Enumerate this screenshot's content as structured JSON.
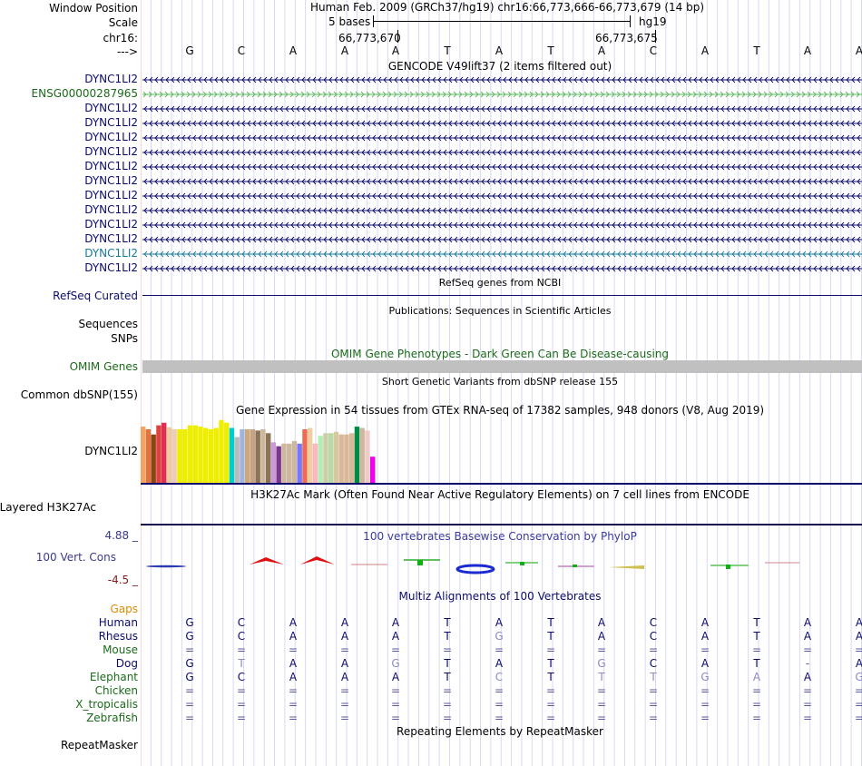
{
  "header": {
    "window_position_label": "Window Position",
    "scale_label": "Scale",
    "chrom_label": "chr16:",
    "arrow_label": "--->",
    "assembly_title": "Human Feb. 2009 (GRCh37/hg19)   chr16:66,773,666-66,773,679 (14 bp)",
    "scale_text": "5 bases",
    "scale_db": "hg19",
    "pos1": "66,773,670",
    "pos2": "66,773,675"
  },
  "sequence": [
    "G",
    "C",
    "A",
    "A",
    "A",
    "T",
    "A",
    "T",
    "A",
    "C",
    "A",
    "T",
    "A",
    "A"
  ],
  "gencode": {
    "title": "GENCODE V49lift37 (2 items filtered out)",
    "items": [
      {
        "label": "DYNC1LI2",
        "color": "#0b0b6e"
      },
      {
        "label": "ENSG00000287965",
        "color": "#1a6b1a"
      },
      {
        "label": "DYNC1LI2",
        "color": "#0b0b6e"
      },
      {
        "label": "DYNC1LI2",
        "color": "#0b0b6e"
      },
      {
        "label": "DYNC1LI2",
        "color": "#0b0b6e"
      },
      {
        "label": "DYNC1LI2",
        "color": "#0b0b6e"
      },
      {
        "label": "DYNC1LI2",
        "color": "#0b0b6e"
      },
      {
        "label": "DYNC1LI2",
        "color": "#0b0b6e"
      },
      {
        "label": "DYNC1LI2",
        "color": "#0b0b6e"
      },
      {
        "label": "DYNC1LI2",
        "color": "#0b0b6e"
      },
      {
        "label": "DYNC1LI2",
        "color": "#0b0b6e"
      },
      {
        "label": "DYNC1LI2",
        "color": "#0b0b6e"
      },
      {
        "label": "DYNC1LI2",
        "color": "#1a7a9a"
      },
      {
        "label": "DYNC1LI2",
        "color": "#0b0b6e"
      }
    ]
  },
  "refseq": {
    "title": "RefSeq genes from NCBI",
    "label": "RefSeq Curated"
  },
  "publications": {
    "title": "Publications: Sequences in Scientific Articles",
    "label1": "Sequences",
    "label2": "SNPs"
  },
  "omim": {
    "title": "OMIM Gene Phenotypes - Dark Green Can Be Disease-causing",
    "label": "OMIM Genes"
  },
  "dbsnp": {
    "title": "Short Genetic Variants from dbSNP release 155",
    "label": "Common dbSNP(155)"
  },
  "gtex": {
    "title": "Gene Expression in 54 tissues from GTEx RNA-seq of 17382 samples, 948 donors (V8, Aug 2019)",
    "label": "DYNC1LI2",
    "bars": [
      {
        "v": 0.86,
        "c": "#f4a460"
      },
      {
        "v": 0.82,
        "c": "#e0743c"
      },
      {
        "v": 0.74,
        "c": "#8b4513"
      },
      {
        "v": 0.88,
        "c": "#e04040"
      },
      {
        "v": 0.92,
        "c": "#e03050"
      },
      {
        "v": 0.85,
        "c": "#eecaa0"
      },
      {
        "v": 0.82,
        "c": "#eeccbb"
      },
      {
        "v": 0.82,
        "c": "#eeee00"
      },
      {
        "v": 0.82,
        "c": "#eeee00"
      },
      {
        "v": 0.88,
        "c": "#eeee00"
      },
      {
        "v": 0.88,
        "c": "#eeee00"
      },
      {
        "v": 0.86,
        "c": "#eeee00"
      },
      {
        "v": 0.84,
        "c": "#eeee00"
      },
      {
        "v": 0.82,
        "c": "#eeee00"
      },
      {
        "v": 0.84,
        "c": "#eeee00"
      },
      {
        "v": 0.96,
        "c": "#eeee00"
      },
      {
        "v": 0.92,
        "c": "#eeee00"
      },
      {
        "v": 0.84,
        "c": "#00cdcd"
      },
      {
        "v": 0.7,
        "c": "#bbbbbb"
      },
      {
        "v": 0.82,
        "c": "#a0b4dd"
      },
      {
        "v": 0.82,
        "c": "#cfa87a"
      },
      {
        "v": 0.82,
        "c": "#c4a484"
      },
      {
        "v": 0.8,
        "c": "#8b7355"
      },
      {
        "v": 0.82,
        "c": "#cdb79e"
      },
      {
        "v": 0.76,
        "c": "#8b7355"
      },
      {
        "v": 0.62,
        "c": "#c89ad8"
      },
      {
        "v": 0.56,
        "c": "#7a378b"
      },
      {
        "v": 0.6,
        "c": "#cdb79e"
      },
      {
        "v": 0.6,
        "c": "#cdb79e"
      },
      {
        "v": 0.64,
        "c": "#cdb79e"
      },
      {
        "v": 0.6,
        "c": "#7777ff"
      },
      {
        "v": 0.82,
        "c": "#ee6a50"
      },
      {
        "v": 0.84,
        "c": "#eecfa1"
      },
      {
        "v": 0.6,
        "c": "#ffb6c1"
      },
      {
        "v": 0.72,
        "c": "#b4eeb4"
      },
      {
        "v": 0.76,
        "c": "#cdcdaa"
      },
      {
        "v": 0.76,
        "c": "#b8d8a8"
      },
      {
        "v": 0.78,
        "c": "#d8c8a0"
      },
      {
        "v": 0.74,
        "c": "#d8b898"
      },
      {
        "v": 0.74,
        "c": "#d8b898"
      },
      {
        "v": 0.76,
        "c": "#d8b898"
      },
      {
        "v": 0.86,
        "c": "#008b45"
      },
      {
        "v": 0.84,
        "c": "#cdb79e"
      },
      {
        "v": 0.8,
        "c": "#eecbc8"
      },
      {
        "v": 0.4,
        "c": "#ee00ee"
      }
    ]
  },
  "h3k27ac": {
    "title": "H3K27Ac Mark (Often Found Near Active Regulatory Elements) on 7 cell lines from ENCODE",
    "label": "Layered H3K27Ac"
  },
  "phylop": {
    "title": "100 vertebrates Basewise Conservation by PhyloP",
    "label": "100 Vert. Cons",
    "ymax": "4.88 _",
    "ymin": "-4.5 _"
  },
  "multiz": {
    "title": "Multiz Alignments of 100 Vertebrates",
    "gaps_label": "Gaps",
    "species": [
      {
        "name": "Human",
        "color": "#0b0b6e",
        "seq": [
          "G",
          "C",
          "A",
          "A",
          "A",
          "T",
          "A",
          "T",
          "A",
          "C",
          "A",
          "T",
          "A",
          "A"
        ]
      },
      {
        "name": "Rhesus",
        "color": "#0b0b6e",
        "seq": [
          "G",
          "C",
          "A",
          "A",
          "A",
          "T",
          "G",
          "T",
          "A",
          "C",
          "A",
          "T",
          "A",
          "A"
        ]
      },
      {
        "name": "Mouse",
        "color": "#1a6b1a",
        "seq": [
          "=",
          "=",
          "=",
          "=",
          "=",
          "=",
          "=",
          "=",
          "=",
          "=",
          "=",
          "=",
          "=",
          "="
        ]
      },
      {
        "name": "Dog",
        "color": "#0b0b6e",
        "seq": [
          "G",
          "T",
          "A",
          "A",
          "G",
          "T",
          "A",
          "T",
          "G",
          "C",
          "A",
          "T",
          "-",
          "A"
        ]
      },
      {
        "name": "Elephant",
        "color": "#1a6b1a",
        "seq": [
          "G",
          "C",
          "A",
          "A",
          "A",
          "T",
          "C",
          "T",
          "T",
          "T",
          "G",
          "A",
          "A",
          "G"
        ]
      },
      {
        "name": "Chicken",
        "color": "#1a6b1a",
        "seq": [
          "=",
          "=",
          "=",
          "=",
          "=",
          "=",
          "=",
          "=",
          "=",
          "=",
          "=",
          "=",
          "=",
          "="
        ]
      },
      {
        "name": "X_tropicalis",
        "color": "#1a6b1a",
        "seq": [
          "=",
          "=",
          "=",
          "=",
          "=",
          "=",
          "=",
          "=",
          "=",
          "=",
          "=",
          "=",
          "=",
          "="
        ]
      },
      {
        "name": "Zebrafish",
        "color": "#1a6b1a",
        "seq": [
          "=",
          "=",
          "=",
          "=",
          "=",
          "=",
          "=",
          "=",
          "=",
          "=",
          "=",
          "=",
          "=",
          "="
        ]
      }
    ]
  },
  "repeatmasker": {
    "title": "Repeating Elements by RepeatMasker",
    "label": "RepeatMasker"
  }
}
